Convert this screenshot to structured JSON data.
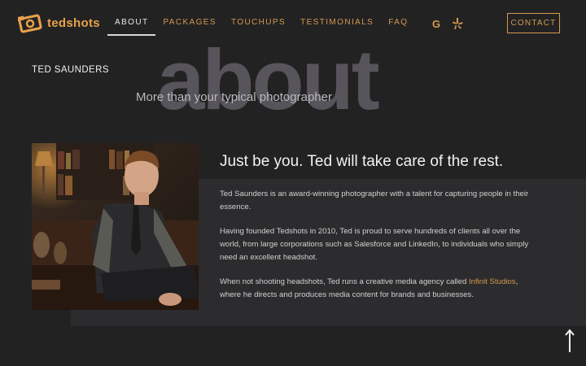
{
  "brand": {
    "name": "tedshots",
    "accent": "#d39a4e"
  },
  "nav": {
    "items": [
      {
        "label": "ABOUT",
        "active": true
      },
      {
        "label": "PACKAGES",
        "active": false
      },
      {
        "label": "TOUCHUPS",
        "active": false
      },
      {
        "label": "TESTIMONIALS",
        "active": false
      },
      {
        "label": "FAQ",
        "active": false
      }
    ],
    "social": {
      "google": "G",
      "yelp_icon": "yelp-icon"
    },
    "contact_label": "CONTACT"
  },
  "hero": {
    "big_word": "about",
    "name": "TED SAUNDERS",
    "tagline": "More than your typical photographer"
  },
  "content": {
    "heading": "Just be you. Ted will take care of the rest.",
    "para1": "Ted Saunders is an award-winning photographer with a talent for capturing people in their essence.",
    "para2": "Having founded Tedshots in 2010, Ted is proud to serve hundreds of clients all over the world, from large corporations such as Salesforce and LinkedIn, to individuals who simply need an excellent headshot.",
    "para3_before": "When not shooting headshots, Ted runs a creative media agency called ",
    "para3_link": "Infinit Studios",
    "para3_after": ", where he directs and produces media content for brands and businesses."
  },
  "scroll_top_icon": "arrow-up-icon"
}
